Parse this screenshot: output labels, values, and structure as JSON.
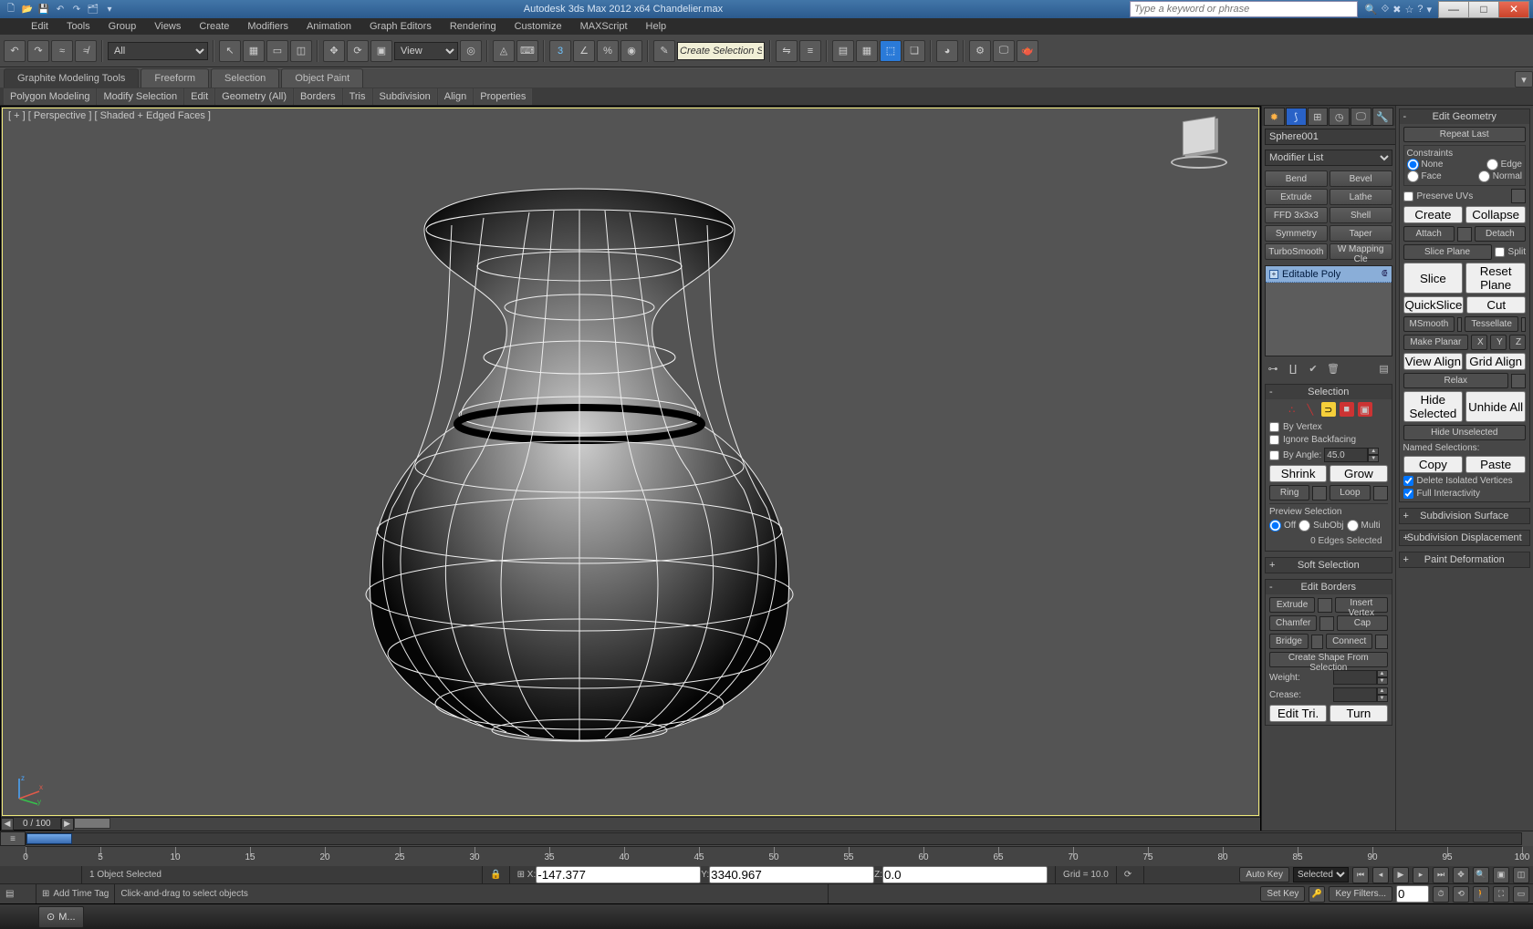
{
  "titlebar": {
    "center": "Autodesk 3ds Max 2012 x64      Chandelier.max",
    "search_placeholder": "Type a keyword or phrase"
  },
  "menu": [
    "Edit",
    "Tools",
    "Group",
    "Views",
    "Create",
    "Modifiers",
    "Animation",
    "Graph Editors",
    "Rendering",
    "Customize",
    "MAXScript",
    "Help"
  ],
  "ribbon_tabs": [
    "Graphite Modeling Tools",
    "Freeform",
    "Selection",
    "Object Paint"
  ],
  "ribbon_sub": [
    "Polygon Modeling",
    "Modify Selection",
    "Edit",
    "Geometry (All)",
    "Borders",
    "Tris",
    "Subdivision",
    "Align",
    "Properties"
  ],
  "toolbar": {
    "selset_sel": "All",
    "refcoord": "View",
    "create_input": "Create Selection Se"
  },
  "viewport": {
    "label": "[ + ] [ Perspective ] [ Shaded + Edged Faces ]",
    "frame_text": "0 / 100"
  },
  "modify": {
    "obj_name": "Sphere001",
    "modlist_label": "Modifier List",
    "mod_buttons": [
      "Bend",
      "Bevel",
      "Extrude",
      "Lathe",
      "FFD 3x3x3",
      "Shell",
      "Symmetry",
      "Taper",
      "TurboSmooth",
      "W Mapping Cle"
    ],
    "stack_item": "Editable Poly"
  },
  "selection": {
    "title": "Selection",
    "by_vertex": "By Vertex",
    "ignore_bf": "Ignore Backfacing",
    "by_angle": "By Angle:",
    "angle_val": "45.0",
    "shrink": "Shrink",
    "grow": "Grow",
    "ring": "Ring",
    "loop": "Loop",
    "preview": "Preview Selection",
    "off": "Off",
    "subobj": "SubObj",
    "multi": "Multi",
    "info": "0 Edges Selected"
  },
  "soft_sel": {
    "title": "Soft Selection"
  },
  "edit_borders": {
    "title": "Edit Borders",
    "extrude": "Extrude",
    "insert_vertex": "Insert Vertex",
    "chamfer": "Chamfer",
    "cap": "Cap",
    "bridge": "Bridge",
    "connect": "Connect",
    "create_shape": "Create Shape From Selection",
    "weight": "Weight:",
    "crease": "Crease:",
    "edit_tri": "Edit Tri.",
    "turn": "Turn"
  },
  "edit_geom": {
    "title": "Edit Geometry",
    "repeat": "Repeat Last",
    "constraints": "Constraints",
    "none": "None",
    "edge": "Edge",
    "face": "Face",
    "normal": "Normal",
    "preserve_uv": "Preserve UVs",
    "create": "Create",
    "collapse": "Collapse",
    "attach": "Attach",
    "detach": "Detach",
    "slice_plane": "Slice Plane",
    "split": "Split",
    "slice": "Slice",
    "reset_plane": "Reset Plane",
    "quickslice": "QuickSlice",
    "cut": "Cut",
    "msmooth": "MSmooth",
    "tessellate": "Tessellate",
    "make_planar": "Make Planar",
    "x": "X",
    "y": "Y",
    "z": "Z",
    "view_align": "View Align",
    "grid_align": "Grid Align",
    "relax": "Relax",
    "hide_sel": "Hide Selected",
    "unhide_all": "Unhide All",
    "hide_unsel": "Hide Unselected",
    "named_sel": "Named Selections:",
    "copy": "Copy",
    "paste": "Paste",
    "del_iso": "Delete Isolated Vertices",
    "full_int": "Full Interactivity",
    "subdiv_surf": "Subdivision Surface",
    "subdiv_disp": "Subdivision Displacement",
    "paint_def": "Paint Deformation"
  },
  "status": {
    "objects": "1 Object Selected",
    "hint": "Click-and-drag to select objects",
    "x": "-147.377",
    "y": "3340.967",
    "z": "0.0",
    "grid": "Grid = 10.0",
    "add_time": "Add Time Tag",
    "auto_key": "Auto Key",
    "set_key": "Set Key",
    "sel_mode": "Selected",
    "key_filters": "Key Filters...",
    "taskbar": "M..."
  },
  "ruler_ticks": [
    0,
    5,
    10,
    15,
    20,
    25,
    30,
    35,
    40,
    45,
    50,
    55,
    60,
    65,
    70,
    75,
    80,
    85,
    90,
    95,
    100
  ]
}
